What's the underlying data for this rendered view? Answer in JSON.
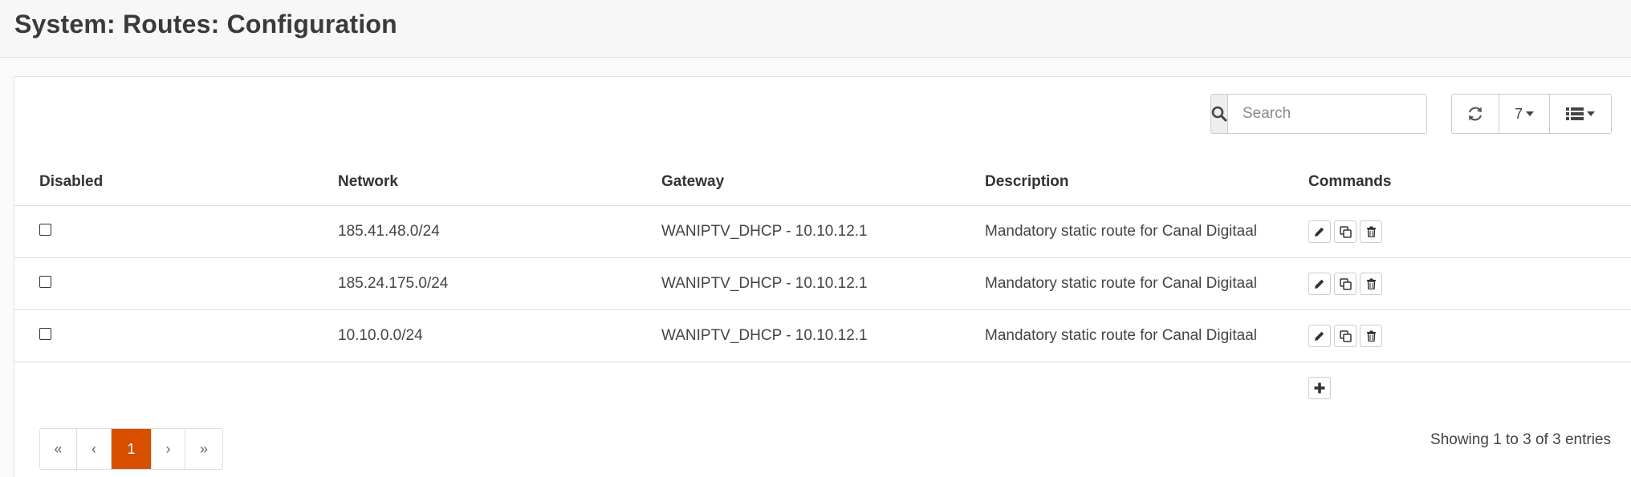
{
  "page": {
    "title": "System: Routes: Configuration"
  },
  "toolbar": {
    "search_placeholder": "Search",
    "page_size": "7",
    "icons": {
      "search": "search-icon",
      "refresh": "refresh-icon",
      "columns": "list-icon"
    }
  },
  "table": {
    "headers": [
      "Disabled",
      "Network",
      "Gateway",
      "Description",
      "Commands"
    ],
    "rows": [
      {
        "disabled": false,
        "network": "185.41.48.0/24",
        "gateway": "WANIPTV_DHCP - 10.10.12.1",
        "description": "Mandatory static route for Canal Digitaal"
      },
      {
        "disabled": false,
        "network": "185.24.175.0/24",
        "gateway": "WANIPTV_DHCP - 10.10.12.1",
        "description": "Mandatory static route for Canal Digitaal"
      },
      {
        "disabled": false,
        "network": "10.10.0.0/24",
        "gateway": "WANIPTV_DHCP - 10.10.12.1",
        "description": "Mandatory static route for Canal Digitaal"
      }
    ]
  },
  "pager": {
    "first": "«",
    "prev": "‹",
    "current": "1",
    "next": "›",
    "last": "»"
  },
  "footer": {
    "entries_text": "Showing 1 to 3 of 3 entries"
  },
  "colors": {
    "accent": "#d94f00"
  }
}
